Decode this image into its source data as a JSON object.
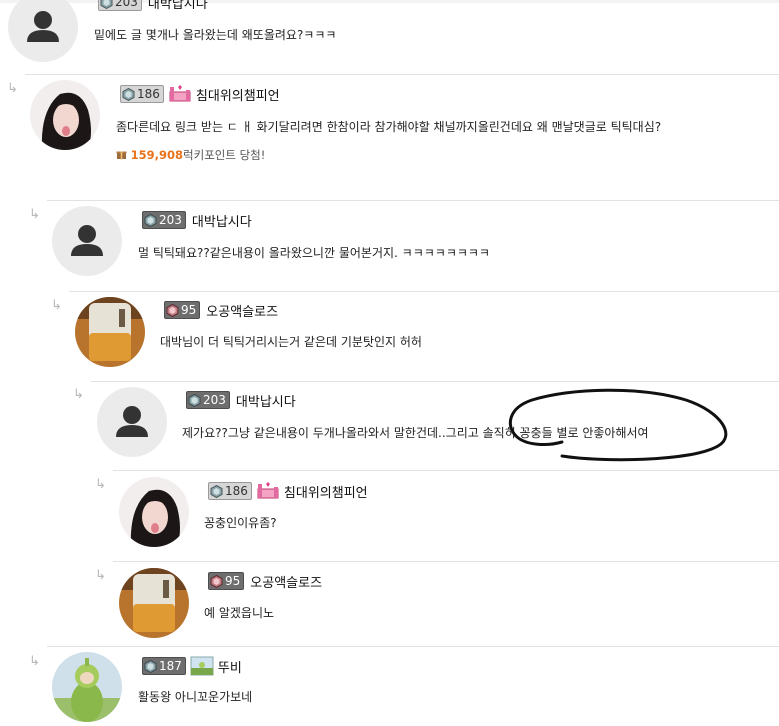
{
  "comments": [
    {
      "nick": "대박납시다",
      "level": "203",
      "text": "밑에도 글 몇개나 올라왔는데 왜또올려요?ㅋㅋㅋ"
    },
    {
      "nick": "침대위의챔피언",
      "level": "186",
      "text": "좀다른데요 링크 받는 ㄷ ㅐ 화기달리려면 한참이라  참가해야할 채널까지올린건데요 왜 맨날댓글로 틱틱대심?",
      "points_num": "159,908",
      "points_text": "럭키포인트 당첨!"
    },
    {
      "nick": "대박납시다",
      "level": "203",
      "text": "멀 틱틱돼요??같은내용이 올라왔으니깐 물어본거지. ㅋㅋㅋㅋㅋㅋㅋㅋ"
    },
    {
      "nick": "오공액슬로즈",
      "level": "95",
      "text": "대박님이 더 틱틱거리시는거 같은데 기분탓인지 허허"
    },
    {
      "nick": "대박납시다",
      "level": "203",
      "text": "제가요??그냥 같은내용이 두개나올라와서 말한건데..그리고 솔직히 꽁충들 별로 안좋아해서여"
    },
    {
      "nick": "침대위의챔피언",
      "level": "186",
      "text": "꽁충인이유좀?"
    },
    {
      "nick": "오공액슬로즈",
      "level": "95",
      "text": "예 알겠읍니노"
    },
    {
      "nick": "뚜비",
      "level": "187",
      "text": "활동왕 아니꼬운가보네"
    }
  ],
  "reply_arrow": "↳",
  "icons": {
    "default_avatar": "person-icon",
    "level": "level-gem-icon",
    "points": "gift-icon"
  },
  "colors": {
    "points": "#e8731a",
    "divider": "#e2e2e2",
    "annotation": "#111111"
  }
}
